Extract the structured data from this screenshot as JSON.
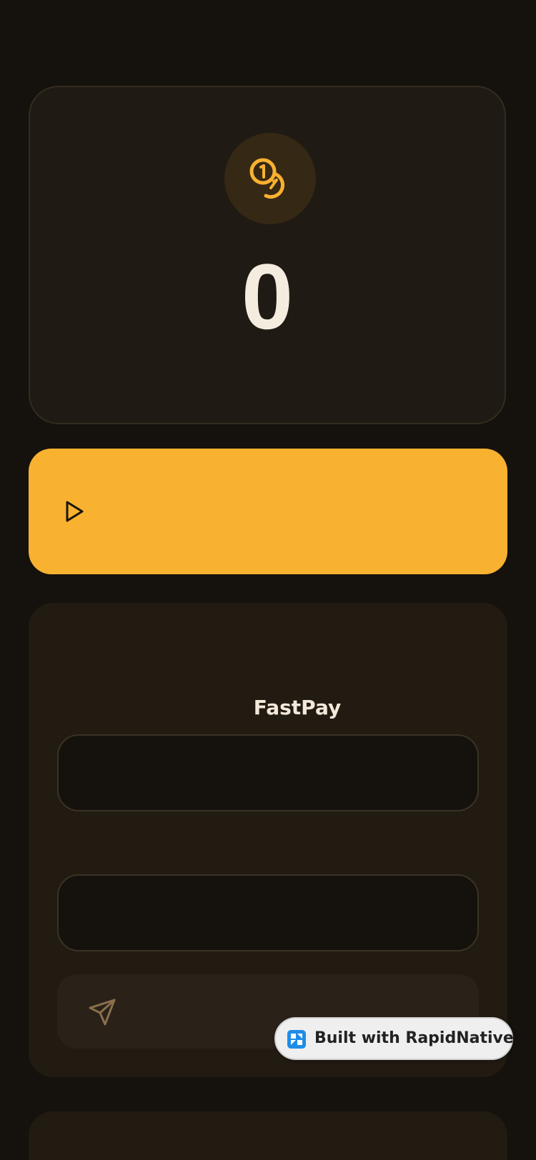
{
  "balance": {
    "value": "0",
    "icon": "coins-icon"
  },
  "play_button": {
    "icon": "play-icon"
  },
  "send_form": {
    "title": "FastPay",
    "field_1": {
      "value": "",
      "placeholder": ""
    },
    "field_2": {
      "value": "",
      "placeholder": ""
    },
    "send_icon": "send-icon"
  },
  "badge": {
    "label": "Built with RapidNative",
    "icon": "rapidnative-logo-icon"
  },
  "colors": {
    "background": "#15120d",
    "card": "#1f1a13",
    "accent": "#f9b130",
    "text": "#f5ece0"
  }
}
